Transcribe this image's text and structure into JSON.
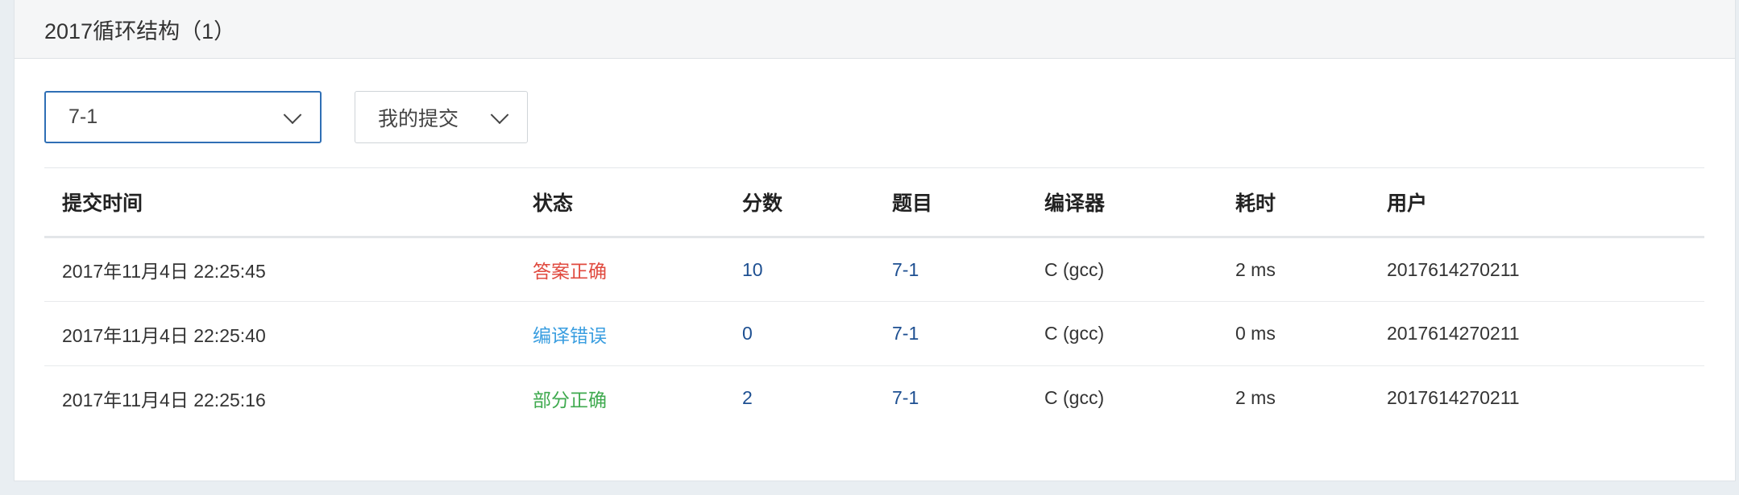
{
  "panel": {
    "title": "2017循环结构（1）"
  },
  "filters": {
    "problem_select": "7-1",
    "scope_select": "我的提交"
  },
  "table": {
    "headers": [
      "提交时间",
      "状态",
      "分数",
      "题目",
      "编译器",
      "耗时",
      "用户"
    ],
    "rows": [
      {
        "time": "2017年11月4日 22:25:45",
        "status": "答案正确",
        "status_kind": "accepted",
        "score": "10",
        "problem": "7-1",
        "compiler": "C (gcc)",
        "duration": "2 ms",
        "user": "2017614270211"
      },
      {
        "time": "2017年11月4日 22:25:40",
        "status": "编译错误",
        "status_kind": "compile-error",
        "score": "0",
        "problem": "7-1",
        "compiler": "C (gcc)",
        "duration": "0 ms",
        "user": "2017614270211"
      },
      {
        "time": "2017年11月4日 22:25:16",
        "status": "部分正确",
        "status_kind": "partial",
        "score": "2",
        "problem": "7-1",
        "compiler": "C (gcc)",
        "duration": "2 ms",
        "user": "2017614270211"
      }
    ]
  },
  "colors": {
    "accepted": "#e04a3f",
    "compile_error": "#3a9ee0",
    "partial": "#3faa4f",
    "link": "#1d4f91",
    "select_focus": "#2f6fb5"
  },
  "icons": {
    "select_caret": "chevron-down-icon"
  }
}
